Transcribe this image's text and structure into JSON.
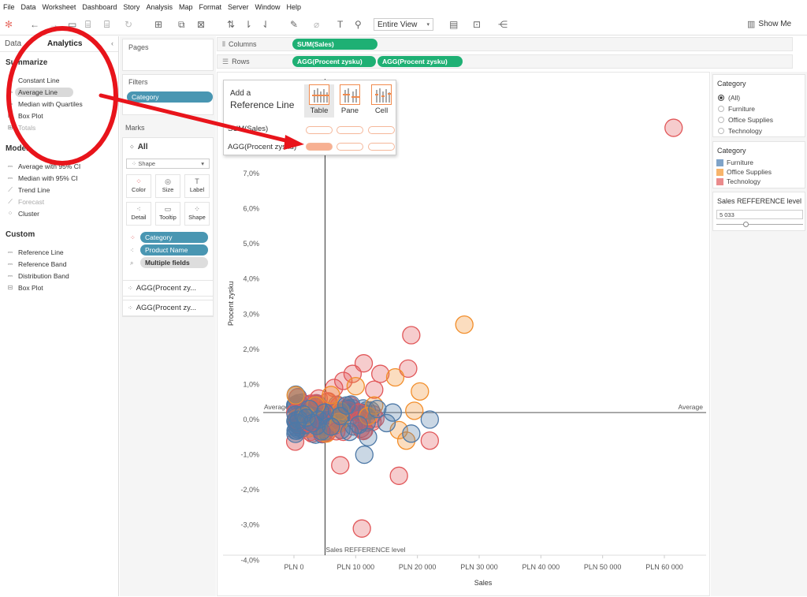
{
  "menu": [
    "File",
    "Data",
    "Worksheet",
    "Dashboard",
    "Story",
    "Analysis",
    "Map",
    "Format",
    "Server",
    "Window",
    "Help"
  ],
  "toolbar": {
    "view_select": "Entire View",
    "show_me": "Show Me"
  },
  "left_pane": {
    "tab_data": "Data",
    "tab_analytics": "Analytics",
    "sections": {
      "summarize": {
        "title": "Summarize",
        "items": [
          {
            "label": "Constant Line",
            "icon": "constant-line-icon"
          },
          {
            "label": "Average Line",
            "icon": "average-line-icon",
            "selected": true
          },
          {
            "label": "Median with Quartiles",
            "icon": "median-quartiles-icon"
          },
          {
            "label": "Box Plot",
            "icon": "box-plot-icon"
          },
          {
            "label": "Totals",
            "icon": "totals-icon",
            "disabled": true
          }
        ]
      },
      "model": {
        "title": "Model",
        "items": [
          {
            "label": "Average with 95% CI",
            "icon": "average-ci-icon"
          },
          {
            "label": "Median with 95% CI",
            "icon": "median-ci-icon"
          },
          {
            "label": "Trend Line",
            "icon": "trend-line-icon"
          },
          {
            "label": "Forecast",
            "icon": "forecast-icon",
            "disabled": true
          },
          {
            "label": "Cluster",
            "icon": "cluster-icon"
          }
        ]
      },
      "custom": {
        "title": "Custom",
        "items": [
          {
            "label": "Reference Line",
            "icon": "reference-line-icon"
          },
          {
            "label": "Reference Band",
            "icon": "reference-band-icon"
          },
          {
            "label": "Distribution Band",
            "icon": "distribution-band-icon"
          },
          {
            "label": "Box Plot",
            "icon": "box-plot-icon"
          }
        ]
      }
    }
  },
  "cards": {
    "pages_title": "Pages",
    "filters_title": "Filters",
    "filter_pill": "Category",
    "marks_title": "Marks",
    "marks_all": "All",
    "mark_type": "Shape",
    "mark_buttons": [
      "Color",
      "Size",
      "Label",
      "Detail",
      "Tooltip",
      "Shape"
    ],
    "mark_pills": [
      "Category",
      "Product Name",
      "Multiple fields"
    ],
    "agg_cards": [
      "AGG(Procent zy...",
      "AGG(Procent zy..."
    ]
  },
  "shelves": {
    "columns_label": "Columns",
    "columns_pills": [
      "SUM(Sales)"
    ],
    "rows_label": "Rows",
    "rows_pills": [
      "AGG(Procent zysku)",
      "AGG(Procent zysku)"
    ]
  },
  "ref_popup": {
    "title_line1": "Add a",
    "title_line2": "Reference Line",
    "scopes": [
      "Table",
      "Pane",
      "Cell"
    ],
    "rows": [
      "SUM(Sales)",
      "AGG(Procent zysku)"
    ]
  },
  "right_pane": {
    "filter_title": "Category",
    "filter_options": [
      "(All)",
      "Furniture",
      "Office Supplies",
      "Technology"
    ],
    "legend_title": "Category",
    "legend": [
      {
        "label": "Furniture",
        "color": "#4e79a7"
      },
      {
        "label": "Office Supplies",
        "color": "#f28e2b"
      },
      {
        "label": "Technology",
        "color": "#e15759"
      }
    ],
    "param_title": "Sales REFFERENCE level",
    "param_value": "5 033"
  },
  "chart_data": {
    "type": "scatter",
    "xlabel": "Sales",
    "ylabel": "Procent zysku",
    "xlim": [
      -3000,
      65000
    ],
    "ylim": [
      -4.0,
      9.0
    ],
    "x_ticks": [
      "PLN 0",
      "PLN 10 000",
      "PLN 20 000",
      "PLN 30 000",
      "PLN 40 000",
      "PLN 50 000",
      "PLN 60 000"
    ],
    "x_tick_values": [
      0,
      10000,
      20000,
      30000,
      40000,
      50000,
      60000
    ],
    "y_ticks": [
      "-4,0%",
      "-3,0%",
      "-2,0%",
      "-1,0%",
      "0,0%",
      "1,0%",
      "2,0%",
      "3,0%",
      "4,0%",
      "5,0%",
      "6,0%",
      "7,0%"
    ],
    "y_tick_values": [
      -4,
      -3,
      -2,
      -1,
      0,
      1,
      2,
      3,
      4,
      5,
      6,
      7
    ],
    "reference_lines": {
      "average_label_left": "Average",
      "average_label_right": "Average",
      "average_y": 0.2,
      "sales_ref_label": "Sales REFFERENCE level",
      "sales_ref_x": 5033
    },
    "series": [
      {
        "name": "Technology",
        "color": "#e15759",
        "points": [
          [
            61500,
            8.3
          ],
          [
            19000,
            2.4
          ],
          [
            18500,
            1.45
          ],
          [
            11300,
            1.6
          ],
          [
            14000,
            1.3
          ],
          [
            9500,
            1.3
          ],
          [
            8000,
            1.1
          ],
          [
            13000,
            0.85
          ],
          [
            6500,
            0.9
          ],
          [
            22000,
            -0.6
          ],
          [
            17000,
            -1.6
          ],
          [
            7500,
            -1.3
          ],
          [
            11000,
            -3.1
          ],
          [
            4000,
            0.6
          ],
          [
            3000,
            0.3
          ],
          [
            2500,
            -0.1
          ],
          [
            10500,
            0.2
          ]
        ]
      },
      {
        "name": "Office Supplies",
        "color": "#f28e2b",
        "points": [
          [
            27600,
            2.7
          ],
          [
            20400,
            0.8
          ],
          [
            19500,
            0.25
          ],
          [
            16400,
            1.2
          ],
          [
            18200,
            -0.6
          ],
          [
            17000,
            -0.3
          ],
          [
            13000,
            0.4
          ],
          [
            10000,
            0.95
          ],
          [
            12000,
            0.1
          ],
          [
            6000,
            0.7
          ],
          [
            3500,
            0.4
          ],
          [
            2000,
            0.1
          ]
        ]
      },
      {
        "name": "Furniture",
        "color": "#4e79a7",
        "points": [
          [
            22000,
            0.0
          ],
          [
            15000,
            -0.1
          ],
          [
            12000,
            -0.5
          ],
          [
            11400,
            -1.0
          ],
          [
            9000,
            -0.35
          ],
          [
            7500,
            0.1
          ],
          [
            6000,
            -0.2
          ],
          [
            4000,
            0.0
          ],
          [
            3000,
            -0.1
          ],
          [
            2000,
            0.05
          ],
          [
            1500,
            0.15
          ],
          [
            800,
            0.0
          ],
          [
            500,
            -0.1
          ],
          [
            2500,
            0.3
          ],
          [
            5000,
            0.2
          ],
          [
            8500,
            0.4
          ],
          [
            13500,
            0.3
          ],
          [
            19000,
            -0.4
          ],
          [
            16000,
            0.2
          ],
          [
            10500,
            -0.15
          ]
        ]
      }
    ]
  }
}
